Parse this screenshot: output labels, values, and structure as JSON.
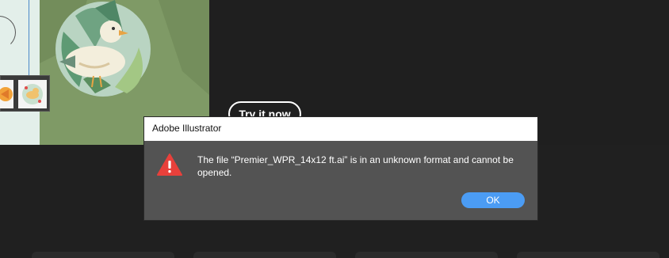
{
  "promo": {
    "cta_label": "Try it now"
  },
  "dialog": {
    "title": "Adobe Illustrator",
    "message": "The file “Premier_WPR_14x12 ft.ai” is in an unknown format and cannot be opened.",
    "ok_label": "OK",
    "icon": "warning-icon",
    "accent_color": "#4b9cf4",
    "warning_color": "#e8403b"
  }
}
